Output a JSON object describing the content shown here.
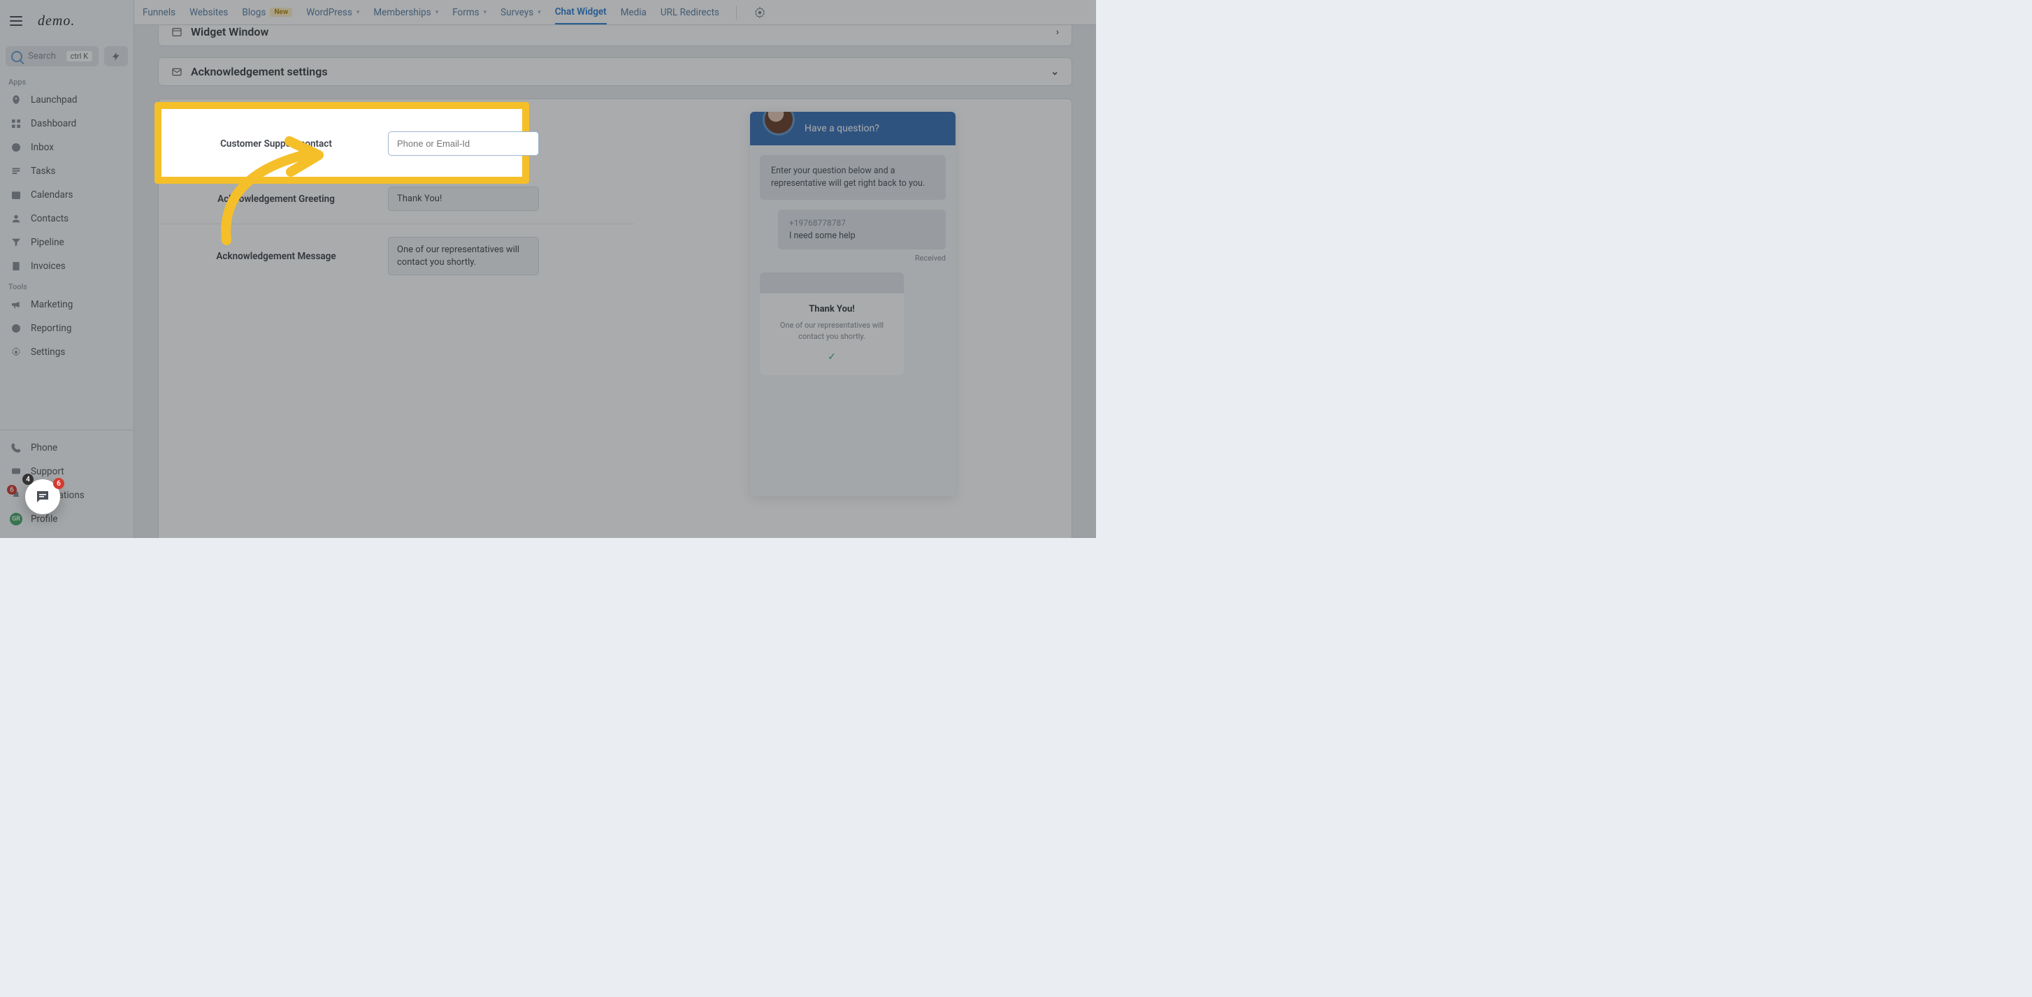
{
  "brand": {
    "logo_text": "demo."
  },
  "search": {
    "label": "Search",
    "shortcut": "ctrl K"
  },
  "sidebar": {
    "sections": {
      "apps_label": "Apps",
      "tools_label": "Tools"
    },
    "items": [
      {
        "label": "Launchpad"
      },
      {
        "label": "Dashboard"
      },
      {
        "label": "Inbox"
      },
      {
        "label": "Tasks"
      },
      {
        "label": "Calendars"
      },
      {
        "label": "Contacts"
      },
      {
        "label": "Pipeline"
      },
      {
        "label": "Invoices"
      }
    ],
    "tools": [
      {
        "label": "Marketing"
      },
      {
        "label": "Reporting"
      },
      {
        "label": "Settings"
      }
    ],
    "footer": [
      {
        "label": "Phone"
      },
      {
        "label": "Support"
      },
      {
        "label": "Notifications",
        "badge": "6"
      },
      {
        "label": "Profile",
        "avatar": "GR"
      }
    ]
  },
  "topnav": {
    "tabs": [
      {
        "label": "Funnels"
      },
      {
        "label": "Websites"
      },
      {
        "label": "Blogs",
        "badge": "New"
      },
      {
        "label": "WordPress",
        "dropdown": true
      },
      {
        "label": "Memberships",
        "dropdown": true
      },
      {
        "label": "Forms",
        "dropdown": true
      },
      {
        "label": "Surveys",
        "dropdown": true
      },
      {
        "label": "Chat Widget",
        "active": true
      },
      {
        "label": "Media"
      },
      {
        "label": "URL Redirects"
      }
    ]
  },
  "cards": {
    "widget_window_title": "Widget Window",
    "ack_settings_title": "Acknowledgement settings"
  },
  "form": {
    "contact": {
      "label": "Customer Support contact",
      "placeholder": "Phone or Email-Id",
      "value": ""
    },
    "greeting": {
      "label": "Acknowledgement Greeting",
      "value": "Thank You!"
    },
    "message": {
      "label": "Acknowledgement Message",
      "value": "One of our representatives will contact you shortly."
    }
  },
  "preview": {
    "header_text": "Have a question?",
    "intro_text": "Enter your question below and a representative will get right back to you.",
    "sample_phone": "+19768778787",
    "sample_msg": "I need some help",
    "received_label": "Received",
    "reply_title": "Thank You!",
    "reply_body": "One of our representatives will contact you shortly."
  },
  "launcher": {
    "badge_dark": "4",
    "badge_red": "6"
  }
}
